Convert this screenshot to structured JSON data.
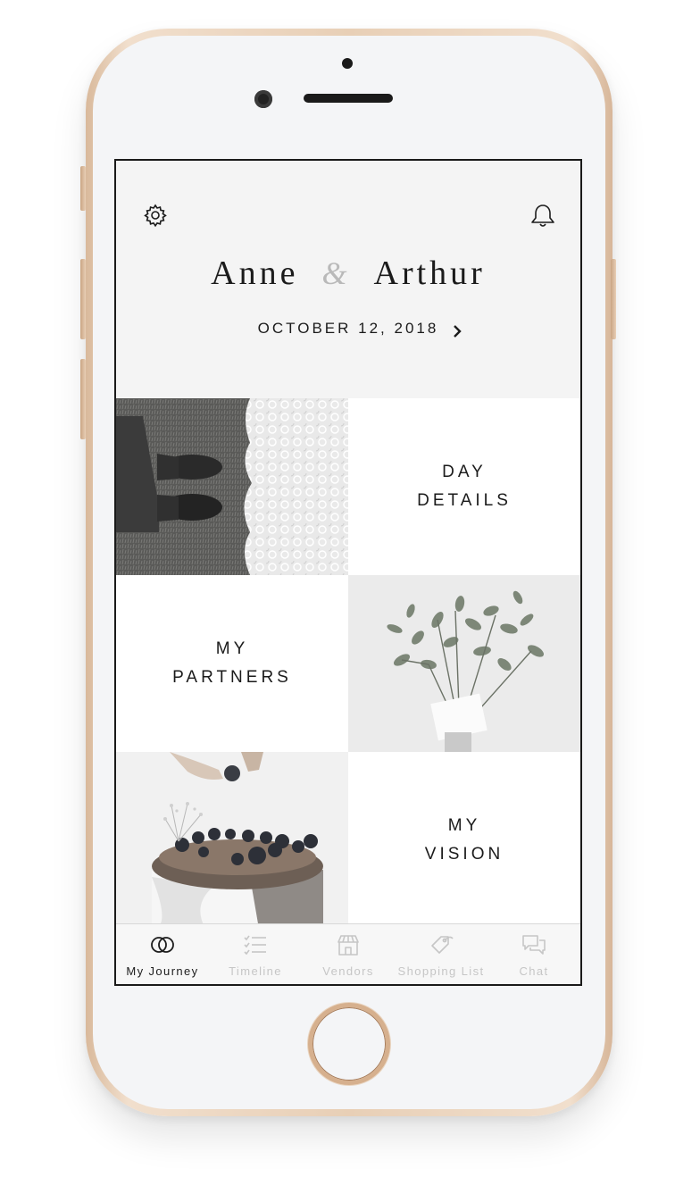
{
  "couple": {
    "name_one": "Anne",
    "ampersand": "&",
    "name_two": "Arthur"
  },
  "wedding_date": "OCTOBER 12, 2018",
  "tiles": {
    "day_details": {
      "line1": "DAY",
      "line2": "DETAILS"
    },
    "my_partners": {
      "line1": "MY",
      "line2": "PARTNERS"
    },
    "my_vision": {
      "line1": "MY",
      "line2": "VISION"
    }
  },
  "tabs": [
    {
      "label": "My Journey",
      "icon": "rings-icon",
      "active": true
    },
    {
      "label": "Timeline",
      "icon": "checklist-icon",
      "active": false
    },
    {
      "label": "Vendors",
      "icon": "store-icon",
      "active": false
    },
    {
      "label": "Shopping List",
      "icon": "tag-icon",
      "active": false
    },
    {
      "label": "Chat",
      "icon": "chat-icon",
      "active": false
    }
  ],
  "icons": {
    "settings": "gear-icon",
    "notifications": "bell-icon",
    "next_date": "chevron-right-icon"
  },
  "colors": {
    "text": "#1b1b1b",
    "tab_inactive": "#c6c6c6",
    "phone_gold": "#e8cfb6"
  }
}
